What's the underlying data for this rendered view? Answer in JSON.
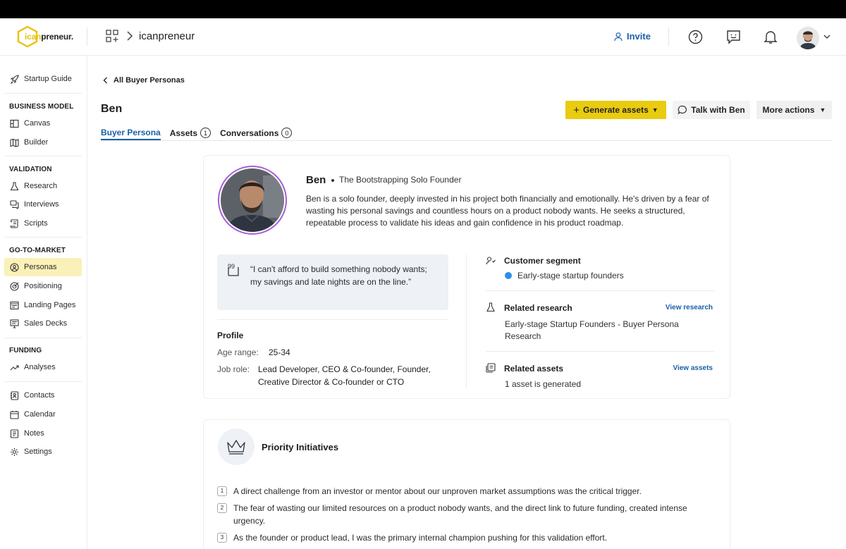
{
  "header": {
    "logo_text_a": "ican",
    "logo_text_b": "preneur.",
    "breadcrumb": "icanpreneur",
    "invite_label": "Invite"
  },
  "sidebar": {
    "items_top": [
      {
        "label": "Startup Guide"
      }
    ],
    "business_model": {
      "title": "BUSINESS MODEL",
      "items": [
        {
          "label": "Canvas"
        },
        {
          "label": "Builder"
        }
      ]
    },
    "validation": {
      "title": "VALIDATION",
      "items": [
        {
          "label": "Research"
        },
        {
          "label": "Interviews"
        },
        {
          "label": "Scripts"
        }
      ]
    },
    "go_to_market": {
      "title": "GO-TO-MARKET",
      "items": [
        {
          "label": "Personas"
        },
        {
          "label": "Positioning"
        },
        {
          "label": "Landing Pages"
        },
        {
          "label": "Sales Decks"
        }
      ]
    },
    "funding": {
      "title": "FUNDING",
      "items": [
        {
          "label": "Analyses"
        }
      ]
    },
    "items_bottom": [
      {
        "label": "Contacts"
      },
      {
        "label": "Calendar"
      },
      {
        "label": "Notes"
      },
      {
        "label": "Settings"
      }
    ]
  },
  "page": {
    "back_label": "All Buyer Personas",
    "title": "Ben",
    "actions": {
      "generate": "Generate assets",
      "talk": "Talk with Ben",
      "more": "More actions"
    },
    "tabs": [
      {
        "label": "Buyer Persona"
      },
      {
        "label": "Assets",
        "count": "1"
      },
      {
        "label": "Conversations",
        "count": "0"
      }
    ]
  },
  "persona": {
    "name": "Ben",
    "subtitle": "The Bootstrapping Solo Founder",
    "description": "Ben is a solo founder, deeply invested in his project both financially and emotionally. He's driven by a fear of wasting his personal savings and countless hours on a product nobody wants. He seeks a structured, repeatable process to validate his ideas and gain confidence in his product roadmap.",
    "quote": "“I can't afford to build something nobody wants; my savings and late nights are on the line.”",
    "profile": {
      "title": "Profile",
      "age_label": "Age range:",
      "age_value": "25-34",
      "job_label": "Job role:",
      "job_value": "Lead Developer, CEO & Co-founder, Founder, Creative Director & Co-founder or CTO"
    },
    "segment": {
      "title": "Customer segment",
      "value": "Early-stage startup founders"
    },
    "research": {
      "title": "Related research",
      "link": "View research",
      "value": "Early-stage Startup Founders - Buyer Persona Research"
    },
    "assets": {
      "title": "Related assets",
      "link": "View assets",
      "value": "1 asset is generated"
    }
  },
  "initiatives": {
    "title": "Priority Initiatives",
    "items": [
      {
        "num": "1",
        "text": "A direct challenge from an investor or mentor about our unproven market assumptions was the critical trigger."
      },
      {
        "num": "2",
        "text": "The fear of wasting our limited resources on a product nobody wants, and the direct link to future funding, created intense urgency."
      },
      {
        "num": "3",
        "text": "As the founder or product lead, I was the primary internal champion pushing for this validation effort."
      }
    ]
  },
  "colors": {
    "accent_yellow": "#e9cb10",
    "link_blue": "#1b5fa8",
    "avatar_ring": "#a65dd8",
    "segment_dot": "#2c8ee6"
  }
}
